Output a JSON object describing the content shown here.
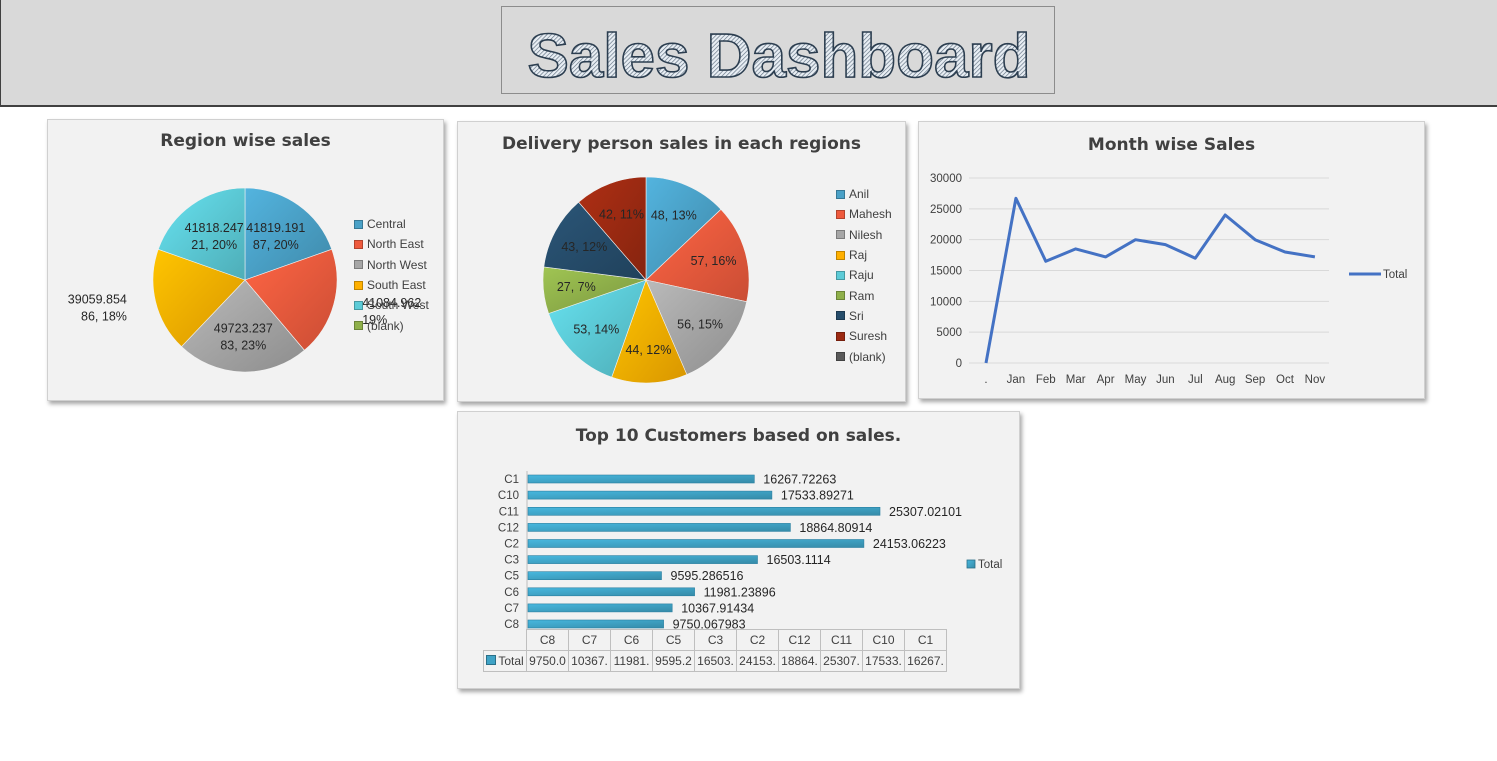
{
  "dashboard": {
    "title": "Sales Dashboard"
  },
  "colors": {
    "Central": "#4aa1c7",
    "North East": "#ee5a3d",
    "North West": "#a6a6a6",
    "South East": "#ffb000",
    "South West": "#5ccbd7",
    "(blank)": "#8fb04a",
    "Anil": "#4aa1c7",
    "Mahesh": "#ee5a3d",
    "Nilesh": "#a6a6a6",
    "Raj": "#ffb000",
    "Raju": "#5ccbd7",
    "Ram": "#8fb04a",
    "Sri": "#264d6b",
    "Suresh": "#9c2a12",
    "blank2": "#595959",
    "line": "#4472c4",
    "bar": "#3fa3c6"
  },
  "charts": {
    "region": {
      "title": "Region wise sales",
      "legend": [
        "Central",
        "North East",
        "North West",
        "South East",
        "South West",
        "(blank)"
      ],
      "labels": [
        [
          "41819.191",
          "87, 20%"
        ],
        [
          "41084.962",
          "19%"
        ],
        [
          "49723.237",
          "83, 23%"
        ],
        [
          "39059.854",
          "86, 18%"
        ],
        [
          "41818.247",
          "21, 20%"
        ]
      ]
    },
    "delivery": {
      "title": "Delivery person sales in each regions",
      "legend": [
        "Anil",
        "Mahesh",
        "Nilesh",
        "Raj",
        "Raju",
        "Ram",
        "Sri",
        "Suresh",
        "(blank)"
      ],
      "labels": [
        "48, 13%",
        "57, 16%",
        "56, 15%",
        "44, 12%",
        "53, 14%",
        "27, 7%",
        "43, 12%",
        "42, 11%"
      ]
    },
    "month": {
      "title": "Month wise Sales",
      "legend": "Total",
      "yticks": [
        "30000",
        "25000",
        "20000",
        "15000",
        "10000",
        "5000",
        "0"
      ]
    },
    "customers": {
      "title": "Top 10 Customers based on sales.",
      "legend": "Total",
      "value_labels": [
        "16267.72263",
        "17533.89271",
        "25307.02101",
        "18864.80914",
        "24153.06223",
        "16503.1114",
        "9595.286516",
        "11981.23896",
        "10367.91434",
        "9750.067983"
      ],
      "table_header": [
        "C8",
        "C7",
        "C6",
        "C5",
        "C3",
        "C2",
        "C12",
        "C11",
        "C10",
        "C1"
      ],
      "table_row_label": "Total",
      "table_values": [
        "9750.0",
        "10367.",
        "11981.",
        "9595.2",
        "16503.",
        "24153.",
        "18864.",
        "25307.",
        "17533.",
        "16267."
      ]
    }
  },
  "chart_data": [
    {
      "type": "pie",
      "title": "Region wise sales",
      "categories": [
        "Central",
        "North East",
        "North West",
        "South East",
        "South West",
        "(blank)"
      ],
      "values": [
        41819.19187,
        41084.962,
        49723.23783,
        39059.85486,
        41818.24721,
        0
      ],
      "percent": [
        20,
        19,
        23,
        18,
        20,
        0
      ],
      "legend": "right"
    },
    {
      "type": "pie",
      "title": "Delivery person sales in each regions",
      "categories": [
        "Anil",
        "Mahesh",
        "Nilesh",
        "Raj",
        "Raju",
        "Ram",
        "Sri",
        "Suresh",
        "(blank)"
      ],
      "values": [
        48,
        57,
        56,
        44,
        53,
        27,
        43,
        42,
        0
      ],
      "percent": [
        13,
        16,
        15,
        12,
        14,
        7,
        12,
        11,
        0
      ],
      "legend": "right"
    },
    {
      "type": "line",
      "title": "Month wise Sales",
      "x": [
        ".",
        "Jan",
        "Feb",
        "Mar",
        "Apr",
        "May",
        "Jun",
        "Jul",
        "Aug",
        "Sep",
        "Oct",
        "Nov"
      ],
      "series": [
        {
          "name": "Total",
          "values": [
            0,
            26700,
            16500,
            18500,
            17200,
            20000,
            19200,
            17000,
            24000,
            20000,
            18000,
            17200
          ]
        }
      ],
      "ylim": [
        0,
        30000
      ],
      "grid": true,
      "legend": "right"
    },
    {
      "type": "bar",
      "orientation": "horizontal",
      "title": "Top 10 Customers based on sales.",
      "categories": [
        "C1",
        "C10",
        "C11",
        "C12",
        "C2",
        "C3",
        "C5",
        "C6",
        "C7",
        "C8"
      ],
      "series": [
        {
          "name": "Total",
          "values": [
            16267.72263,
            17533.89271,
            25307.02101,
            18864.80914,
            24153.06223,
            16503.1114,
            9595.286516,
            11981.23896,
            10367.91434,
            9750.067983
          ]
        }
      ],
      "legend": "right"
    }
  ]
}
